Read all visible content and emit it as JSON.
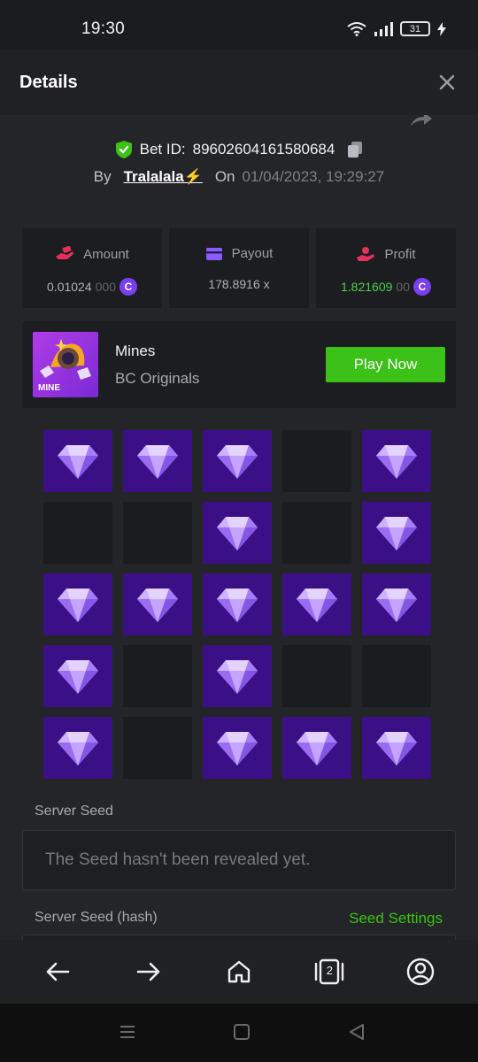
{
  "status_bar": {
    "time": "19:30",
    "battery": "31"
  },
  "header": {
    "title": "Details"
  },
  "bet": {
    "id_label": "Bet ID:",
    "id_value": "89602604161580684",
    "by_label": "By",
    "username": "Tralalala⚡",
    "on_label": "On",
    "date": "01/04/2023, 19:29:27"
  },
  "stats": {
    "amount": {
      "label": "Amount",
      "value_main": "0.01024",
      "value_faded": "000"
    },
    "payout": {
      "label": "Payout",
      "value": "178.8916 x"
    },
    "profit": {
      "label": "Profit",
      "value_main": "1.821609",
      "value_faded": "00"
    },
    "coin_symbol": "C"
  },
  "game": {
    "name": "Mines",
    "provider": "BC Originals",
    "thumb_text": "MINE",
    "play_label": "Play Now"
  },
  "board": [
    [
      1,
      1,
      1,
      0,
      1
    ],
    [
      0,
      0,
      1,
      0,
      1
    ],
    [
      1,
      1,
      1,
      1,
      1
    ],
    [
      1,
      0,
      1,
      0,
      0
    ],
    [
      1,
      0,
      1,
      1,
      1
    ]
  ],
  "seeds": {
    "server_seed_label": "Server Seed",
    "server_seed_value": "The Seed hasn't been revealed yet.",
    "server_hash_label": "Server Seed (hash)",
    "seed_settings_label": "Seed Settings"
  },
  "nav": {
    "tab_count": "2"
  },
  "colors": {
    "accent_green": "#3bc117",
    "gem_bg": "#3b0f85",
    "coin": "#7a3ff0"
  }
}
